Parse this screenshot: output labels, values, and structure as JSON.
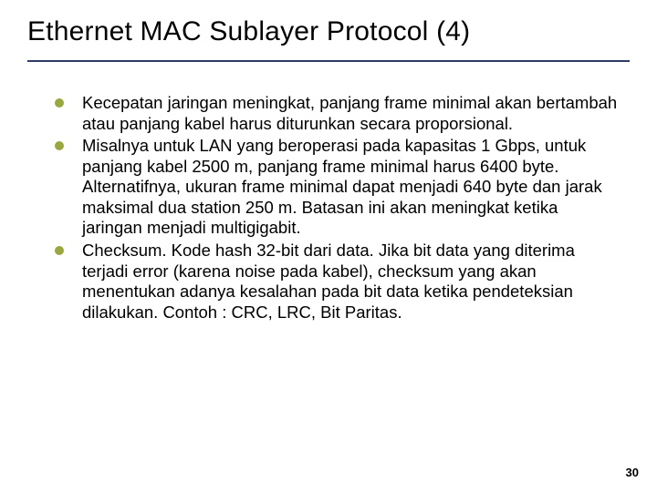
{
  "title": "Ethernet MAC Sublayer Protocol (4)",
  "bullets": [
    "Kecepatan jaringan meningkat, panjang frame minimal akan bertambah atau panjang kabel harus diturunkan secara proporsional.",
    "Misalnya untuk LAN yang beroperasi pada kapasitas 1 Gbps, untuk panjang kabel 2500 m, panjang frame minimal harus 6400 byte. Alternatifnya, ukuran frame minimal dapat menjadi 640 byte dan jarak maksimal dua station 250 m. Batasan ini akan meningkat ketika jaringan menjadi multigigabit.",
    "Checksum. Kode hash 32-bit dari data. Jika bit data yang diterima terjadi error (karena noise pada kabel), checksum yang akan menentukan adanya kesalahan pada bit data ketika pendeteksian dilakukan. Contoh : CRC, LRC, Bit Paritas."
  ],
  "page_number": "30",
  "accent_color": "#9aa63e",
  "rule_color": "#2c3a66"
}
